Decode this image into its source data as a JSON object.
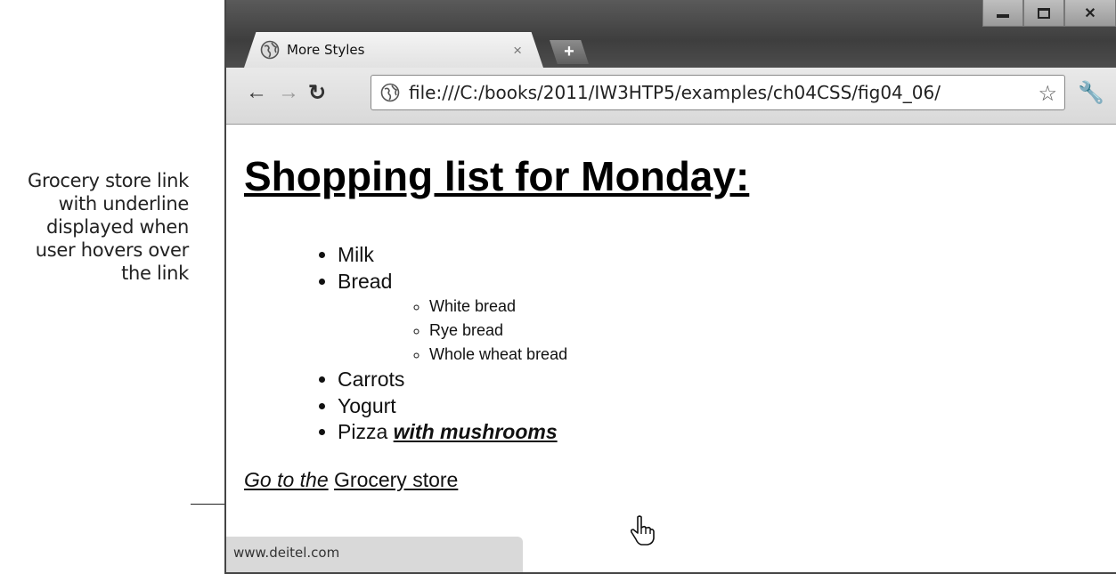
{
  "callout": {
    "lines": [
      "Grocery store link",
      "with underline",
      "displayed when",
      "user hovers over",
      "the link"
    ]
  },
  "browser": {
    "tab_title": "More Styles",
    "tab_close": "×",
    "new_tab": "+",
    "url": "file:///C:/books/2011/IW3HTP5/examples/ch04CSS/fig04_06/",
    "status_text": "www.deitel.com"
  },
  "page": {
    "heading": "Shopping list for Monday:",
    "items": [
      "Milk",
      "Bread",
      "Carrots",
      "Yogurt"
    ],
    "bread_types": [
      "White bread",
      "Rye bread",
      "Whole wheat bread"
    ],
    "pizza": "Pizza",
    "pizza_emphasis": "with mushrooms",
    "link_prefix": "Go to the",
    "link_text": "Grocery store"
  }
}
